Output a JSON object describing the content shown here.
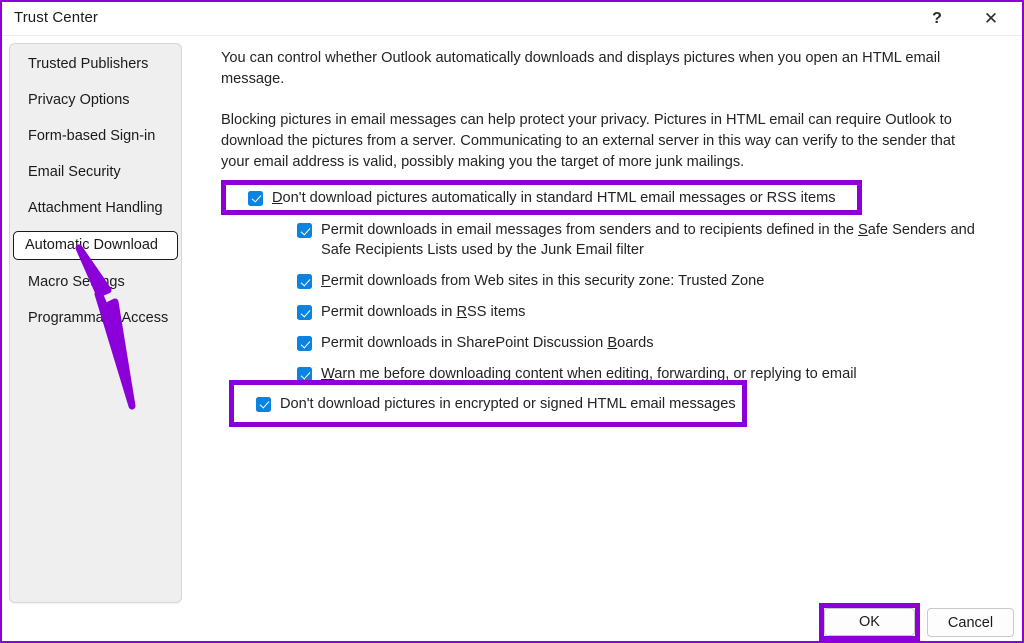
{
  "window": {
    "title": "Trust Center",
    "help_icon": "question-mark-icon",
    "help_glyph": "?",
    "close_icon": "close-icon",
    "close_glyph": "✕"
  },
  "sidebar": {
    "items": [
      {
        "label": "Trusted Publishers",
        "selected": false
      },
      {
        "label": "Privacy Options",
        "selected": false
      },
      {
        "label": "Form-based Sign-in",
        "selected": false
      },
      {
        "label": "Email Security",
        "selected": false
      },
      {
        "label": "Attachment Handling",
        "selected": false
      },
      {
        "label": "Automatic Download",
        "selected": true
      },
      {
        "label": "Macro Settings",
        "selected": false
      },
      {
        "label": "Programmatic Access",
        "selected": false
      }
    ]
  },
  "main": {
    "paragraph_1": "You can control whether Outlook automatically downloads and displays pictures when you open an HTML email message.",
    "paragraph_2": "Blocking pictures in email messages can help protect your privacy. Pictures in HTML email can require Outlook to download the pictures from a server. Communicating to an external server in this way can verify to the sender that your email address is valid, possibly making you the target of more junk mailings.",
    "option_main": {
      "label": "Don't download pictures automatically in standard HTML email messages or RSS items",
      "accel": "D",
      "checked": true,
      "highlighted": true
    },
    "sub_options": [
      {
        "label": "Permit downloads in email messages from senders and to recipients defined in the Safe Senders and Safe Recipients Lists used by the Junk Email filter",
        "accel": "S",
        "checked": true
      },
      {
        "label": "Permit downloads from Web sites in this security zone: Trusted Zone",
        "accel": "P",
        "checked": true
      },
      {
        "label": "Permit downloads in RSS items",
        "accel": "R",
        "checked": true
      },
      {
        "label": "Permit downloads in SharePoint Discussion Boards",
        "accel": "B",
        "checked": true
      },
      {
        "label": "Warn me before downloading content when editing, forwarding, or replying to email",
        "accel": "W",
        "checked": true
      }
    ],
    "option_encrypted": {
      "label": "Don't download pictures in encrypted or signed HTML email messages",
      "checked": true,
      "highlighted": true
    }
  },
  "footer": {
    "ok_label": "OK",
    "cancel_label": "Cancel"
  },
  "annotations": {
    "arrow_color": "#8B00D8",
    "highlight_color": "#8B00D8",
    "checkbox_color": "#0A84E0",
    "arrow_points_to": "Automatic Download"
  }
}
